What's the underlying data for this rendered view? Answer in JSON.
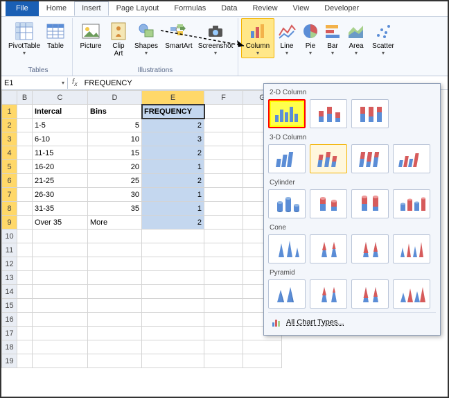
{
  "tabs": {
    "file": "File",
    "home": "Home",
    "insert": "Insert",
    "page_layout": "Page Layout",
    "formulas": "Formulas",
    "data": "Data",
    "review": "Review",
    "view": "View",
    "developer": "Developer"
  },
  "ribbon": {
    "tables": {
      "pivot": "PivotTable",
      "table": "Table",
      "group": "Tables"
    },
    "illus": {
      "picture": "Picture",
      "clipart": "Clip Art",
      "shapes": "Shapes",
      "smartart": "SmartArt",
      "screenshot": "Screenshot",
      "group": "Illustrations"
    },
    "charts": {
      "column": "Column",
      "line": "Line",
      "pie": "Pie",
      "bar": "Bar",
      "area": "Area",
      "scatter": "Scatter"
    }
  },
  "namebox": "E1",
  "formula": "FREQUENCY",
  "columns": [
    "B",
    "C",
    "D",
    "E",
    "F",
    "G"
  ],
  "rowcount": 19,
  "table": {
    "headers": {
      "c": "Intercal",
      "d": "Bins",
      "e": "FREQUENCY"
    },
    "rows": [
      {
        "c": "1-5",
        "d": "5",
        "e": "2"
      },
      {
        "c": "6-10",
        "d": "10",
        "e": "3"
      },
      {
        "c": "11-15",
        "d": "15",
        "e": "2"
      },
      {
        "c": "16-20",
        "d": "20",
        "e": "1"
      },
      {
        "c": "21-25",
        "d": "25",
        "e": "2"
      },
      {
        "c": "26-30",
        "d": "30",
        "e": "1"
      },
      {
        "c": "31-35",
        "d": "35",
        "e": "1"
      },
      {
        "c": "Over 35",
        "d": "More",
        "e": "2"
      }
    ]
  },
  "dropdown": {
    "s2d": "2-D Column",
    "s3d": "3-D Column",
    "cyl": "Cylinder",
    "cone": "Cone",
    "pyr": "Pyramid",
    "all": "All Chart Types..."
  }
}
